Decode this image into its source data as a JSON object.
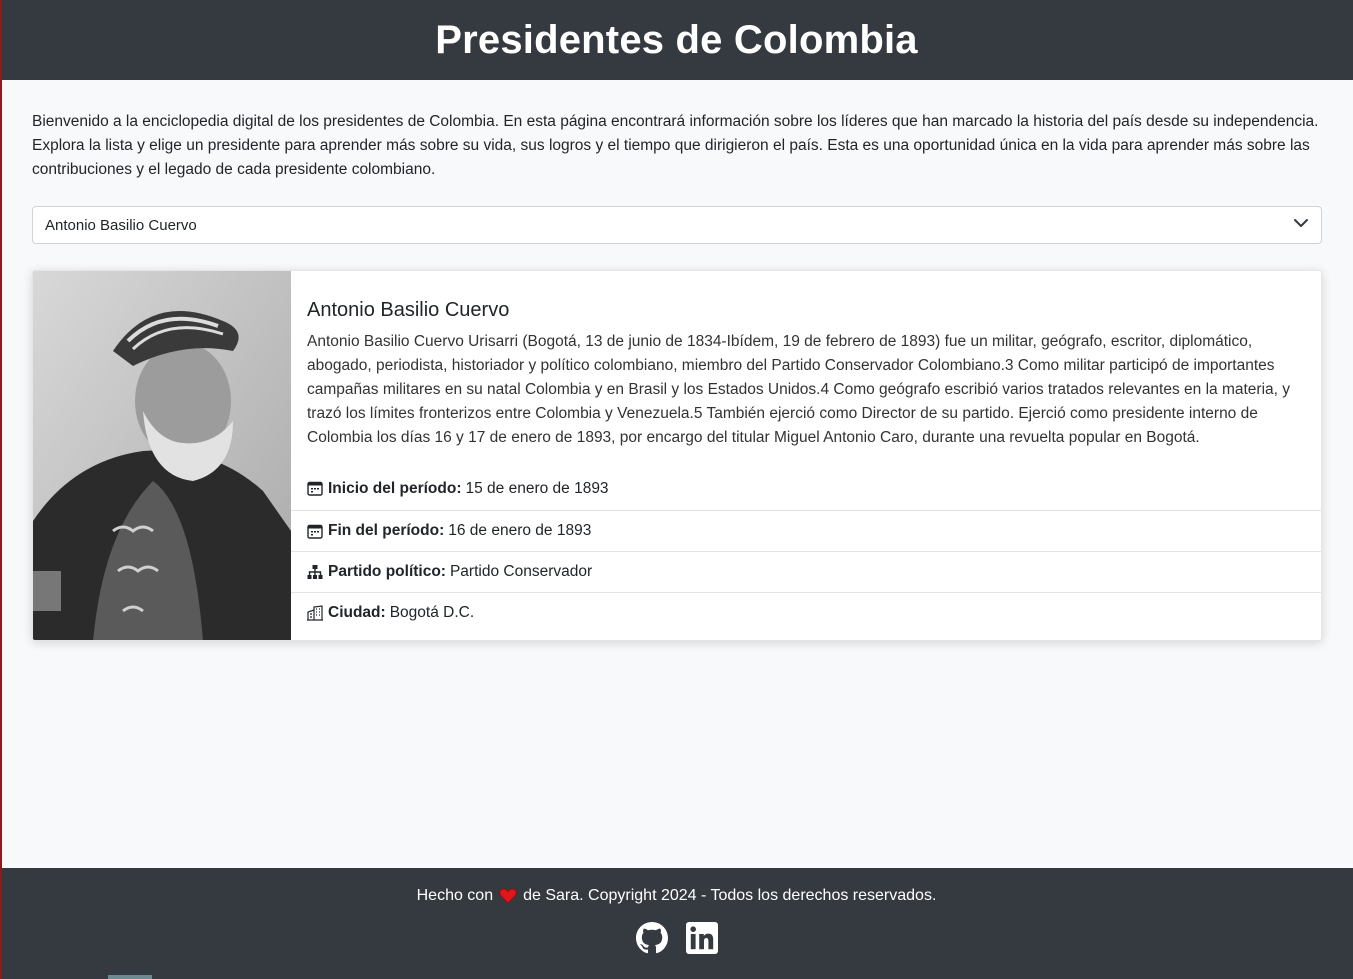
{
  "header": {
    "title": "Presidentes de Colombia"
  },
  "intro": "Bienvenido a la enciclopedia digital de los presidentes de Colombia. En esta página encontrará información sobre los líderes que han marcado la historia del país desde su independencia. Explora la lista y elige un presidente para aprender más sobre su vida, sus logros y el tiempo que dirigieron el país. Esta es una oportunidad única en la vida para aprender más sobre las contribuciones y el legado de cada presidente colombiano.",
  "select": {
    "selected": "Antonio Basilio Cuervo"
  },
  "president": {
    "name": "Antonio Basilio Cuervo",
    "bio": "Antonio Basilio Cuervo Urisarri (Bogotá, 13 de junio de 1834-Ibídem, 19 de febrero de 1893) fue un militar, geógrafo, escritor, diplomático, abogado, periodista, historiador y político colombiano, miembro del Partido Conservador Colombiano.3 Como militar participó de importantes campañas militares en su natal Colombia y en Brasil y los Estados Unidos.4 Como geógrafo escribió varios tratados relevantes en la materia, y trazó los límites fronterizos entre Colombia y Venezuela.5 También ejerció como Director de su partido. Ejerció como presidente interno de Colombia los días 16 y 17 de enero de 1893, por encargo del titular Miguel Antonio Caro, durante una revuelta popular en Bogotá.",
    "details": [
      {
        "icon": "calendar-icon",
        "label": "Inicio del período:",
        "value": "15 de enero de 1893"
      },
      {
        "icon": "calendar-icon",
        "label": "Fin del período:",
        "value": "16 de enero de 1893"
      },
      {
        "icon": "diagram-icon",
        "label": "Partido político:",
        "value": "Partido Conservador"
      },
      {
        "icon": "buildings-icon",
        "label": "Ciudad:",
        "value": "Bogotá D.C."
      }
    ]
  },
  "footer": {
    "made_with": "Hecho con",
    "rest": "de Sara. Copyright 2024 - Todos los derechos reservados.",
    "heart_color": "#e0161b",
    "socials": [
      "github-icon",
      "linkedin-icon"
    ]
  },
  "colors": {
    "header_bg": "#343a40",
    "page_bg": "#f8f9fa"
  }
}
